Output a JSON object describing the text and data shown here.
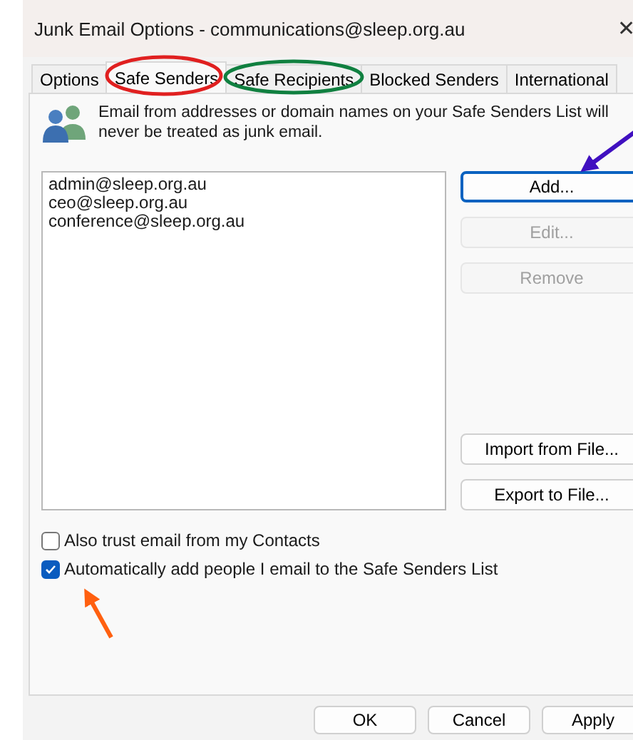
{
  "window": {
    "title": "Junk Email Options - communications@sleep.org.au",
    "close": "✕"
  },
  "tabs": [
    {
      "label": "Options",
      "selected": false
    },
    {
      "label": "Safe Senders",
      "selected": true
    },
    {
      "label": "Safe Recipients",
      "selected": false
    },
    {
      "label": "Blocked Senders",
      "selected": false
    },
    {
      "label": "International",
      "selected": false
    }
  ],
  "description": "Email from addresses or domain names on your Safe Senders List will never be treated as junk email.",
  "list": [
    "admin@sleep.org.au",
    "ceo@sleep.org.au",
    "conference@sleep.org.au"
  ],
  "side_buttons": [
    {
      "label": "Add...",
      "disabled": false,
      "focused": true
    },
    {
      "label": "Edit...",
      "disabled": true,
      "focused": false
    },
    {
      "label": "Remove",
      "disabled": true,
      "focused": false
    },
    {
      "label": "Import from File...",
      "disabled": false,
      "focused": false
    },
    {
      "label": "Export to File...",
      "disabled": false,
      "focused": false
    }
  ],
  "checkboxes": [
    {
      "label": "Also trust email from my Contacts",
      "checked": false
    },
    {
      "label": "Automatically add people I email to the Safe Senders List",
      "checked": true
    }
  ],
  "buttons": [
    "OK",
    "Cancel",
    "Apply"
  ],
  "annotations": [
    {
      "kind": "ellipse",
      "color": "#e02020"
    },
    {
      "kind": "ellipse",
      "color": "#108040"
    },
    {
      "kind": "arrow",
      "color": "#4010c0"
    },
    {
      "kind": "arrow",
      "color": "#ff6010"
    }
  ]
}
